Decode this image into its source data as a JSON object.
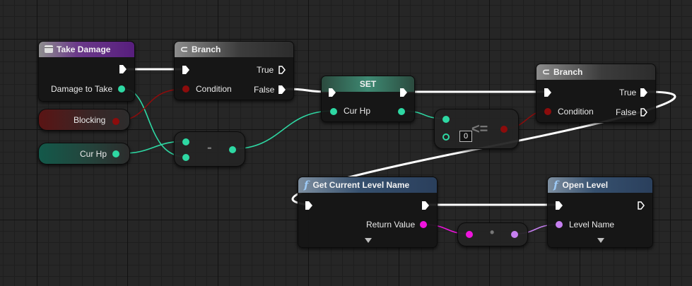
{
  "graph": {
    "nodes": {
      "take_damage": {
        "title": "Take Damage",
        "output_label": "Damage to Take"
      },
      "branch1": {
        "title": "Branch",
        "condition": "Condition",
        "true": "True",
        "false": "False"
      },
      "get_blocking": {
        "label": "Blocking"
      },
      "get_curhp": {
        "label": "Cur Hp"
      },
      "subtract": {
        "op": "-"
      },
      "set": {
        "title": "SET",
        "input_label": "Cur Hp"
      },
      "lessequal": {
        "op": "<=",
        "default": "0"
      },
      "branch2": {
        "title": "Branch",
        "condition": "Condition",
        "true": "True",
        "false": "False"
      },
      "get_level_name": {
        "title": "Get Current Level Name",
        "output_label": "Return Value"
      },
      "conversion": {
        "op": "•"
      },
      "open_level": {
        "title": "Open Level",
        "input_label": "Level Name"
      }
    },
    "pin_colors": {
      "exec": "#ffffff",
      "float": "#2ed8a3",
      "bool": "#8c0c0c",
      "string": "#ee14dd",
      "name": "#c67ff0"
    },
    "icons": {
      "event": "event-icon",
      "branch": "branch-icon",
      "function": "function-icon"
    }
  }
}
